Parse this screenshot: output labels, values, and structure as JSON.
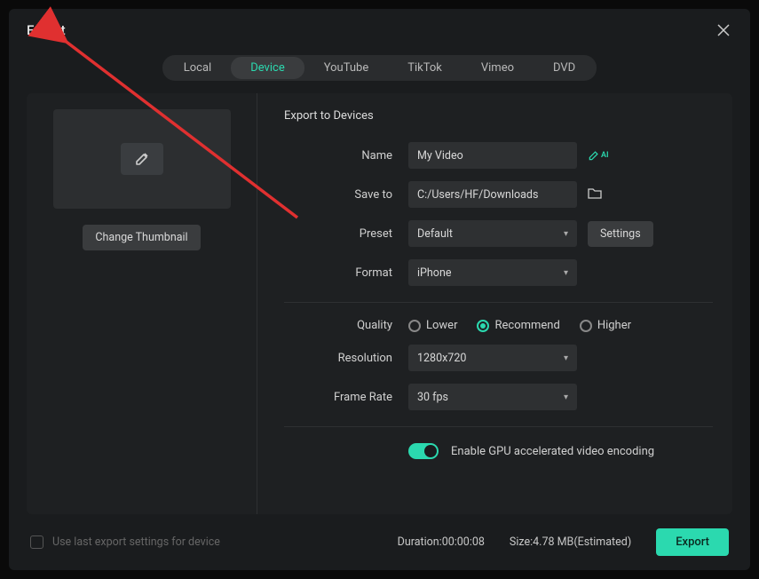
{
  "dialog": {
    "title": "Export",
    "tabs": [
      "Local",
      "Device",
      "YouTube",
      "TikTok",
      "Vimeo",
      "DVD"
    ],
    "active_tab": "Device",
    "change_thumbnail_label": "Change Thumbnail",
    "section_title": "Export to Devices",
    "fields": {
      "name_label": "Name",
      "name_value": "My Video",
      "saveto_label": "Save to",
      "saveto_value": "C:/Users/HF/Downloads",
      "preset_label": "Preset",
      "preset_value": "Default",
      "settings_button": "Settings",
      "format_label": "Format",
      "format_value": "iPhone",
      "quality_label": "Quality",
      "quality_options": [
        "Lower",
        "Recommend",
        "Higher"
      ],
      "quality_selected": "Recommend",
      "resolution_label": "Resolution",
      "resolution_value": "1280x720",
      "framerate_label": "Frame Rate",
      "framerate_value": "30 fps",
      "gpu_toggle_label": "Enable GPU accelerated video encoding",
      "gpu_toggle_on": true
    },
    "footer": {
      "use_last_label": "Use last export settings for device",
      "duration_label": "Duration:",
      "duration_value": "00:00:08",
      "size_label": "Size:",
      "size_value": "4.78 MB(Estimated)",
      "export_button": "Export"
    }
  }
}
